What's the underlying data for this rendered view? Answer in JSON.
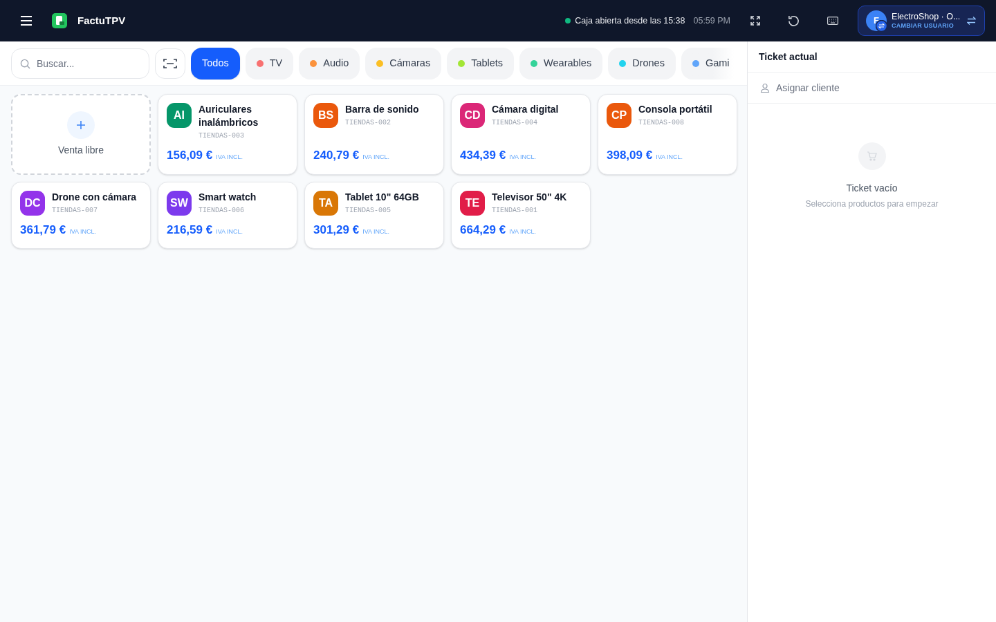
{
  "header": {
    "app_name": "FactuTPV",
    "status": "Caja abierta desde las 15:38",
    "time": "05:59 PM",
    "user": {
      "initial": "F",
      "name": "ElectroShop · O...",
      "action": "CAMBIAR USUARIO"
    }
  },
  "search": {
    "placeholder": "Buscar..."
  },
  "categories": [
    {
      "label": "Todos",
      "selected": true
    },
    {
      "label": "TV",
      "selected": false,
      "color": "#f87171"
    },
    {
      "label": "Audio",
      "selected": false,
      "color": "#fb923c"
    },
    {
      "label": "Cámaras",
      "selected": false,
      "color": "#fbbf24"
    },
    {
      "label": "Tablets",
      "selected": false,
      "color": "#a3e635"
    },
    {
      "label": "Wearables",
      "selected": false,
      "color": "#34d399"
    },
    {
      "label": "Drones",
      "selected": false,
      "color": "#22d3ee"
    },
    {
      "label": "Gami",
      "selected": false,
      "color": "#60a5fa"
    }
  ],
  "products": [
    {
      "kind": "free",
      "label": "Venta libre"
    },
    {
      "kind": "product",
      "initials": "AI",
      "color": "#059669",
      "name": "Auriculares inalámbricos",
      "sku": "TIENDAS-003",
      "price": "156,09 €",
      "tax": "IVA INCL."
    },
    {
      "kind": "product",
      "initials": "BS",
      "color": "#ea580c",
      "name": "Barra de sonido",
      "sku": "TIENDAS-002",
      "price": "240,79 €",
      "tax": "IVA INCL."
    },
    {
      "kind": "product",
      "initials": "CD",
      "color": "#db2777",
      "name": "Cámara digital",
      "sku": "TIENDAS-004",
      "price": "434,39 €",
      "tax": "IVA INCL."
    },
    {
      "kind": "product",
      "initials": "CP",
      "color": "#ea580c",
      "name": "Consola portátil",
      "sku": "TIENDAS-008",
      "price": "398,09 €",
      "tax": "IVA INCL."
    },
    {
      "kind": "product",
      "initials": "DC",
      "color": "#9333ea",
      "name": "Drone con cámara",
      "sku": "TIENDAS-007",
      "price": "361,79 €",
      "tax": "IVA INCL."
    },
    {
      "kind": "product",
      "initials": "SW",
      "color": "#7c3aed",
      "name": "Smart watch",
      "sku": "TIENDAS-006",
      "price": "216,59 €",
      "tax": "IVA INCL."
    },
    {
      "kind": "product",
      "initials": "TA",
      "color": "#d97706",
      "name": "Tablet 10\" 64GB",
      "sku": "TIENDAS-005",
      "price": "301,29 €",
      "tax": "IVA INCL."
    },
    {
      "kind": "product",
      "initials": "TE",
      "color": "#e11d48",
      "name": "Televisor 50\" 4K",
      "sku": "TIENDAS-001",
      "price": "664,29 €",
      "tax": "IVA INCL."
    }
  ],
  "ticket": {
    "title": "Ticket actual",
    "assign": "Asignar cliente",
    "empty_title": "Ticket vacío",
    "empty_text": "Selecciona productos para empezar"
  }
}
